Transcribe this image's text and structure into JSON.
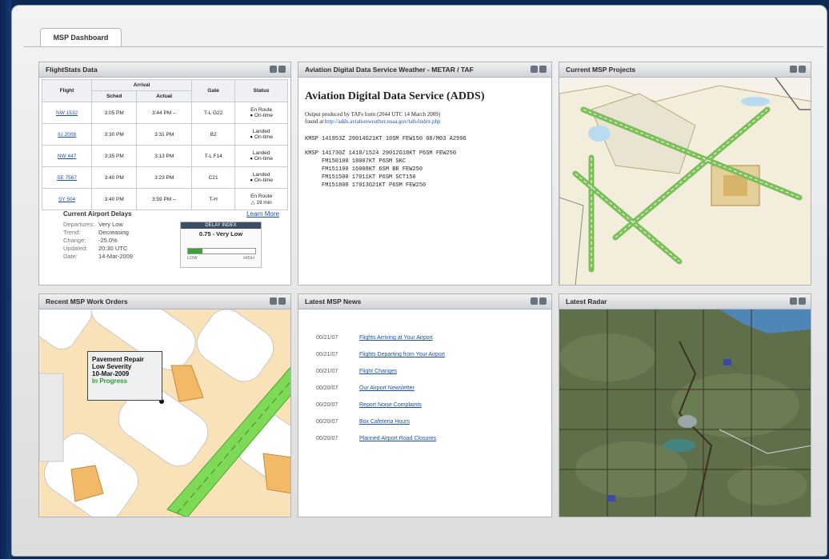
{
  "tab": "MSP Dashboard",
  "panels": {
    "flightstats": "FlightStats Data",
    "weather": "Aviation Digital Data Service Weather - METAR / TAF",
    "projects": "Current MSP Projects",
    "workorders": "Recent MSP Work Orders",
    "news": "Latest MSP News",
    "radar": "Latest Radar"
  },
  "flights": {
    "group_header": "Arrival",
    "headers": [
      "Flight",
      "Sched",
      "Actual",
      "Gate",
      "Status"
    ],
    "rows": [
      {
        "flight": "NW 1532",
        "sched": "3:05 PM",
        "actual": "3:44 PM --",
        "gate": "T-L G22",
        "status": "En Route",
        "sub": "● On-time"
      },
      {
        "flight": "IU 2008",
        "sched": "3:30 PM",
        "actual": "3:31 PM",
        "gate": "B2",
        "status": "Landed",
        "sub": "● On-time"
      },
      {
        "flight": "NW 447",
        "sched": "3:35 PM",
        "actual": "3:13 PM",
        "gate": "T-L F14",
        "status": "Landed",
        "sub": "● On-time"
      },
      {
        "flight": "SE 7567",
        "sched": "3:40 PM",
        "actual": "3:23 PM",
        "gate": "C21",
        "status": "Landed",
        "sub": "● On-time"
      },
      {
        "flight": "SY 504",
        "sched": "3:40 PM",
        "actual": "3:59 PM --",
        "gate": "T-H",
        "status": "En Route",
        "sub": "△ 19 min"
      }
    ]
  },
  "delays": {
    "title": "Current Airport Delays",
    "learn_more": "Learn More",
    "rows": [
      {
        "k": "Departures:",
        "v": "Very Low"
      },
      {
        "k": "Trend:",
        "v": "Decreasing"
      },
      {
        "k": "Change:",
        "v": "-25.0%"
      },
      {
        "k": "Updated:",
        "v": "20:30 UTC"
      },
      {
        "k": "Date:",
        "v": "14-Mar-2009"
      }
    ],
    "gauge_title": "DELAY INDEX",
    "gauge_value": "0.75 - Very Low",
    "gauge_fill_pct": 22,
    "gauge_low": "LOW",
    "gauge_high": "HIGH"
  },
  "weather": {
    "heading": "Aviation Digital Data Service (ADDS)",
    "output_line": "Output produced by TAFs form (2044 UTC 14 March 2009)",
    "found_at": "found at ",
    "url": "http://adds.aviationweather.noaa.gov/tafs/index.php",
    "metar": "KMSP 141953Z 29014G21KT 10SM FEW150 08/M03 A2996",
    "taf": "KMSP 141730Z 1418/1524 29012G18KT P6SM FEW250\n     FM150100 18007KT P6SM SKC\n     FM151100 16008KT 6SM BR FEW250\n     FM151500 17011KT P6SM SCT150\n     FM151800 17013G21KT P6SM FEW250"
  },
  "workorder": {
    "title": "Pavement Repair",
    "severity": "Low Severity",
    "date": "10-Mar-2009",
    "status": "In Progress"
  },
  "news": [
    {
      "date": "00/21/07",
      "title": "Flights Arriving at Your Airport"
    },
    {
      "date": "00/21/07",
      "title": "Flights Departing from Your Airport"
    },
    {
      "date": "00/21/07",
      "title": "Flight Changes"
    },
    {
      "date": "00/20/07",
      "title": "Our Airport Newsletter"
    },
    {
      "date": "00/20/07",
      "title": "Report Noise Complaints"
    },
    {
      "date": "00/20/07",
      "title": "Box Cafeteria Hours"
    },
    {
      "date": "00/20/07",
      "title": "Planned Airport Road Closures"
    }
  ],
  "colors": {
    "link": "#1a4fb8",
    "progress": "#2c9b2c",
    "runway": "#6fcf4a"
  }
}
